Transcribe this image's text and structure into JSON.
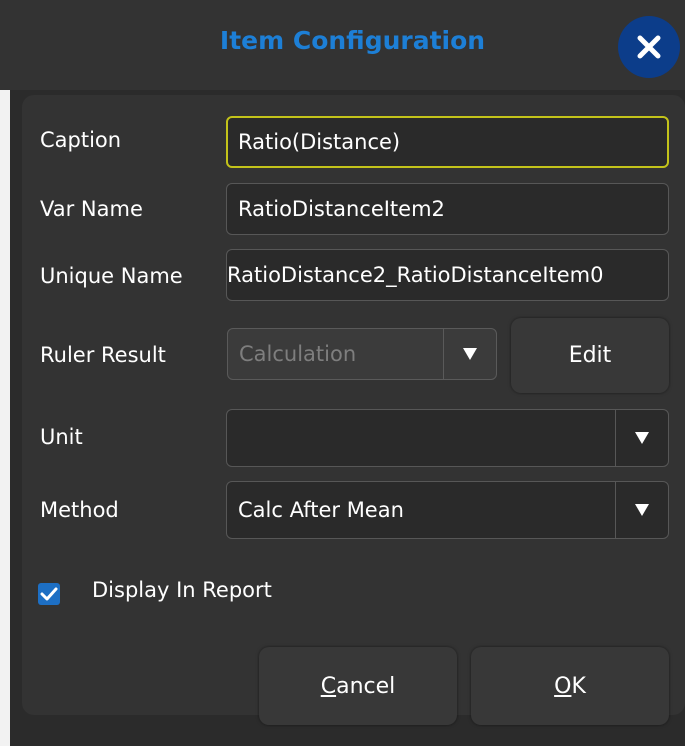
{
  "dialog": {
    "title": "Item Configuration",
    "accent_color": "#1d7fd6",
    "close_icon": "close-icon"
  },
  "form": {
    "caption": {
      "label": "Caption",
      "value": "Ratio(Distance)"
    },
    "var_name": {
      "label": "Var Name",
      "value": "RatioDistanceItem2"
    },
    "unique_name": {
      "label": "Unique Name",
      "value": "RatioDistance2_RatioDistanceItem0"
    },
    "ruler_result": {
      "label": "Ruler Result",
      "value": "Calculation",
      "edit_label": "Edit"
    },
    "unit": {
      "label": "Unit",
      "value": ""
    },
    "method": {
      "label": "Method",
      "value": "Calc After Mean"
    },
    "display_in_report": {
      "label": "Display In Report",
      "checked": true
    }
  },
  "buttons": {
    "cancel_first": "C",
    "cancel_rest": "ancel",
    "ok_first": "O",
    "ok_rest": "K"
  }
}
